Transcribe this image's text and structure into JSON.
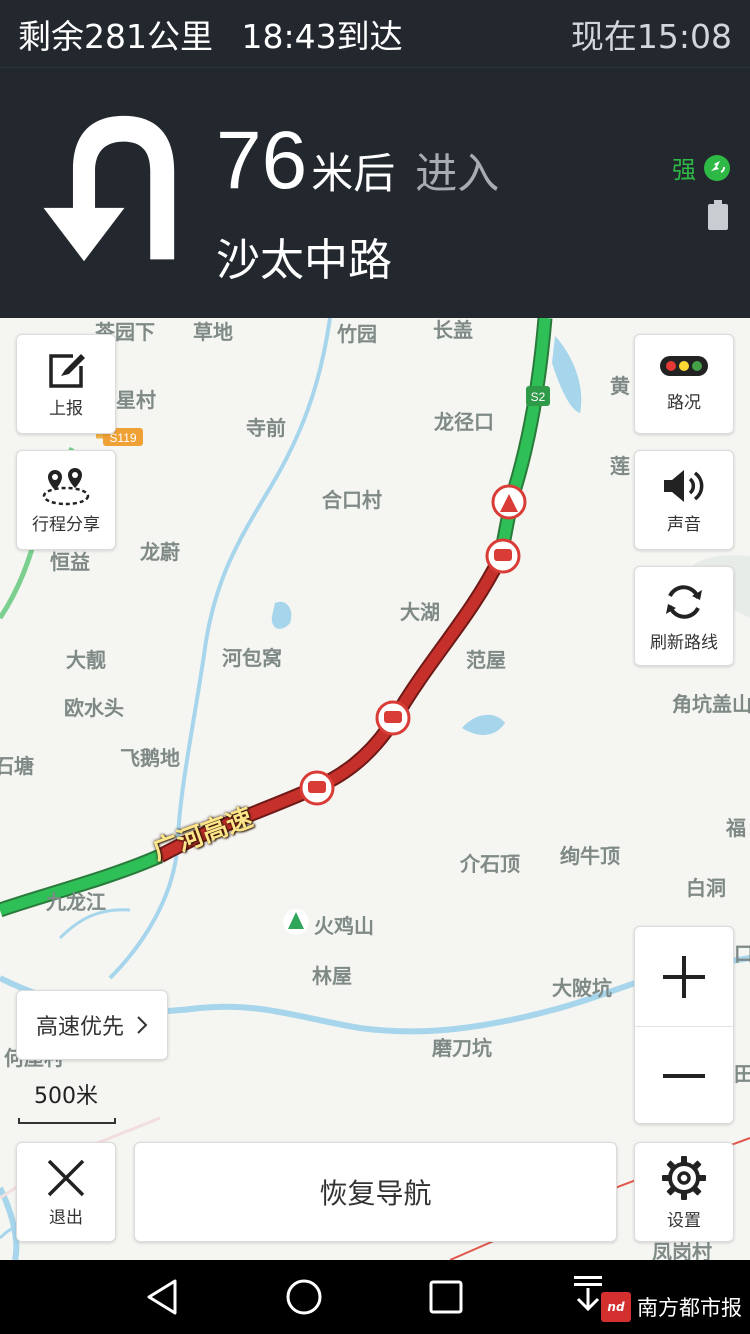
{
  "status": {
    "remaining": "剩余281公里",
    "arrival": "18:43到达",
    "now": "现在15:08"
  },
  "guide": {
    "distance_value": "76",
    "distance_unit": "米后",
    "action": "进入",
    "road_name": "沙太中路",
    "signal_label": "强",
    "maneuver_icon": "u-turn-icon"
  },
  "map": {
    "places": {
      "chayuanxia": "茶园下",
      "caodi": "草地",
      "zhuyuan": "竹园",
      "changgai": "长盖",
      "xingcun": "星村",
      "huang": "黄",
      "siqian": "寺前",
      "longjingkou": "龙径口",
      "lian": "莲",
      "hekoucun": "合口村",
      "longwei": "龙蔚",
      "hengyi": "恒益",
      "dahu": "大湖",
      "dajing": "大靓",
      "hebaowo": "河包窝",
      "fanwu": "范屋",
      "jiaokenggai": "角坑盖山",
      "oushuitou": "欧水头",
      "feiedi": "飞鹅地",
      "shitang": "石塘",
      "fu": "福",
      "jieshiding": "介石顶",
      "xuniuding": "绚牛顶",
      "baidong": "白洞",
      "jiulongjiang": "九龙江",
      "huojishan": "火鸡山",
      "linwu": "林屋",
      "dabokeng": "大陂坑",
      "modaokeng": "磨刀坑",
      "fenggangcun": "凤岗村",
      "helicun": "何屋村",
      "tian": "田",
      "kou": "口"
    },
    "road_badges": {
      "s2": "S2",
      "s119": "S119"
    },
    "highway_label": "广河高速",
    "colors": {
      "smooth": "#2fbf57",
      "congested": "#c6302b",
      "water": "#a7d6ec",
      "incident": "#d93c37"
    }
  },
  "controls": {
    "report": "上报",
    "share_trip": "行程分享",
    "traffic": "路况",
    "sound": "声音",
    "refresh_route": "刷新路线",
    "route_preference": "高速优先",
    "scale": "500米",
    "exit": "退出",
    "resume_nav": "恢复导航",
    "settings": "设置"
  },
  "watermark": {
    "logo_text": "nd",
    "name": "南方都市报"
  }
}
